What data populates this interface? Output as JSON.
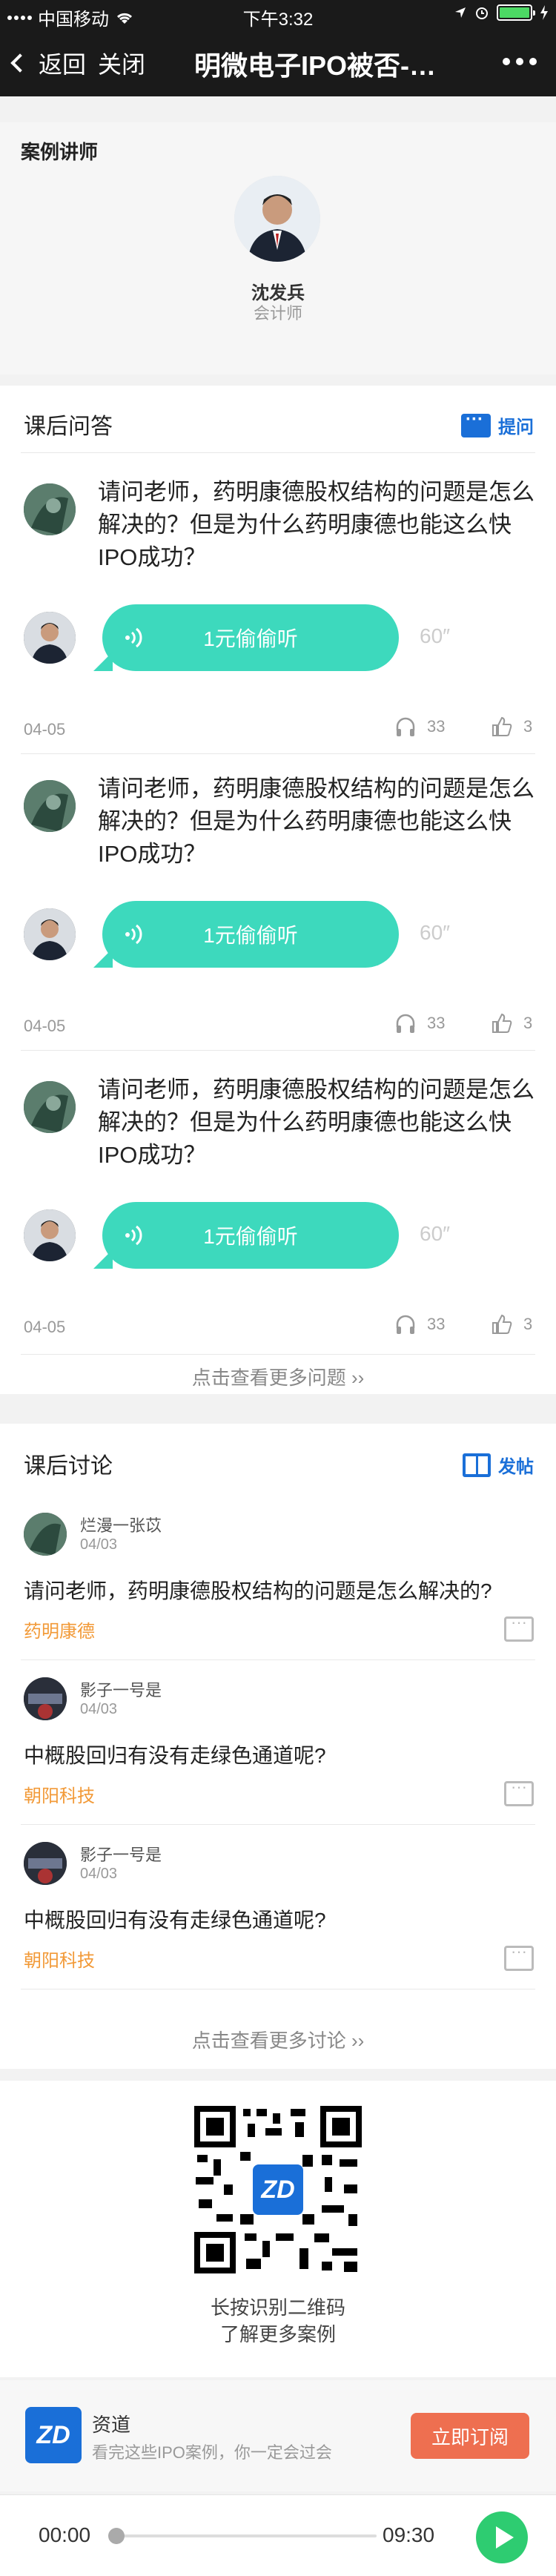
{
  "status_bar": {
    "carrier": "中国移动",
    "time": "下午3:32"
  },
  "nav": {
    "back_label": "返回",
    "close_label": "关闭",
    "title": "明微电子IPO被否-…"
  },
  "lecturer": {
    "section_title": "案例讲师",
    "name": "沈发兵",
    "role": "会计师"
  },
  "qa": {
    "section_title": "课后问答",
    "ask_label": "提问",
    "items": [
      {
        "question": "请问老师，药明康德股权结构的问题是怎么解决的？但是为什么药明康德也能这么快IPO成功？",
        "listen_label": "1元偷偷听",
        "duration": "60″",
        "date": "04-05",
        "listens": "33",
        "likes": "3"
      },
      {
        "question": "请问老师，药明康德股权结构的问题是怎么解决的？但是为什么药明康德也能这么快IPO成功？",
        "listen_label": "1元偷偷听",
        "duration": "60″",
        "date": "04-05",
        "listens": "33",
        "likes": "3"
      },
      {
        "question": "请问老师，药明康德股权结构的问题是怎么解决的？但是为什么药明康德也能这么快IPO成功？",
        "listen_label": "1元偷偷听",
        "duration": "60″",
        "date": "04-05",
        "listens": "33",
        "likes": "3"
      }
    ],
    "more_label": "点击查看更多问题"
  },
  "discussion": {
    "section_title": "课后讨论",
    "post_label": "发帖",
    "items": [
      {
        "author": "烂漫一张苡",
        "date": "04/03",
        "text": "请问老师，药明康德股权结构的问题是怎么解决的?",
        "tag": "药明康德"
      },
      {
        "author": "影子一号是",
        "date": "04/03",
        "text": "中概股回归有没有走绿色通道呢?",
        "tag": "朝阳科技"
      },
      {
        "author": "影子一号是",
        "date": "04/03",
        "text": "中概股回归有没有走绿色通道呢?",
        "tag": "朝阳科技"
      }
    ],
    "more_label": "点击查看更多讨论"
  },
  "qr": {
    "caption_1": "长按识别二维码",
    "caption_2": "了解更多案例"
  },
  "promo": {
    "name": "资道",
    "desc": "看完这些IPO案例，你一定会过会",
    "subscribe_label": "立即订阅"
  },
  "player": {
    "current_time": "00:00",
    "total_time": "09:30",
    "progress": 0
  },
  "colors": {
    "accent": "#1a6fd8",
    "bubble": "#3dd9bd",
    "tag": "#f29a38",
    "subscribe": "#ee6f50",
    "play": "#2ecc71"
  }
}
